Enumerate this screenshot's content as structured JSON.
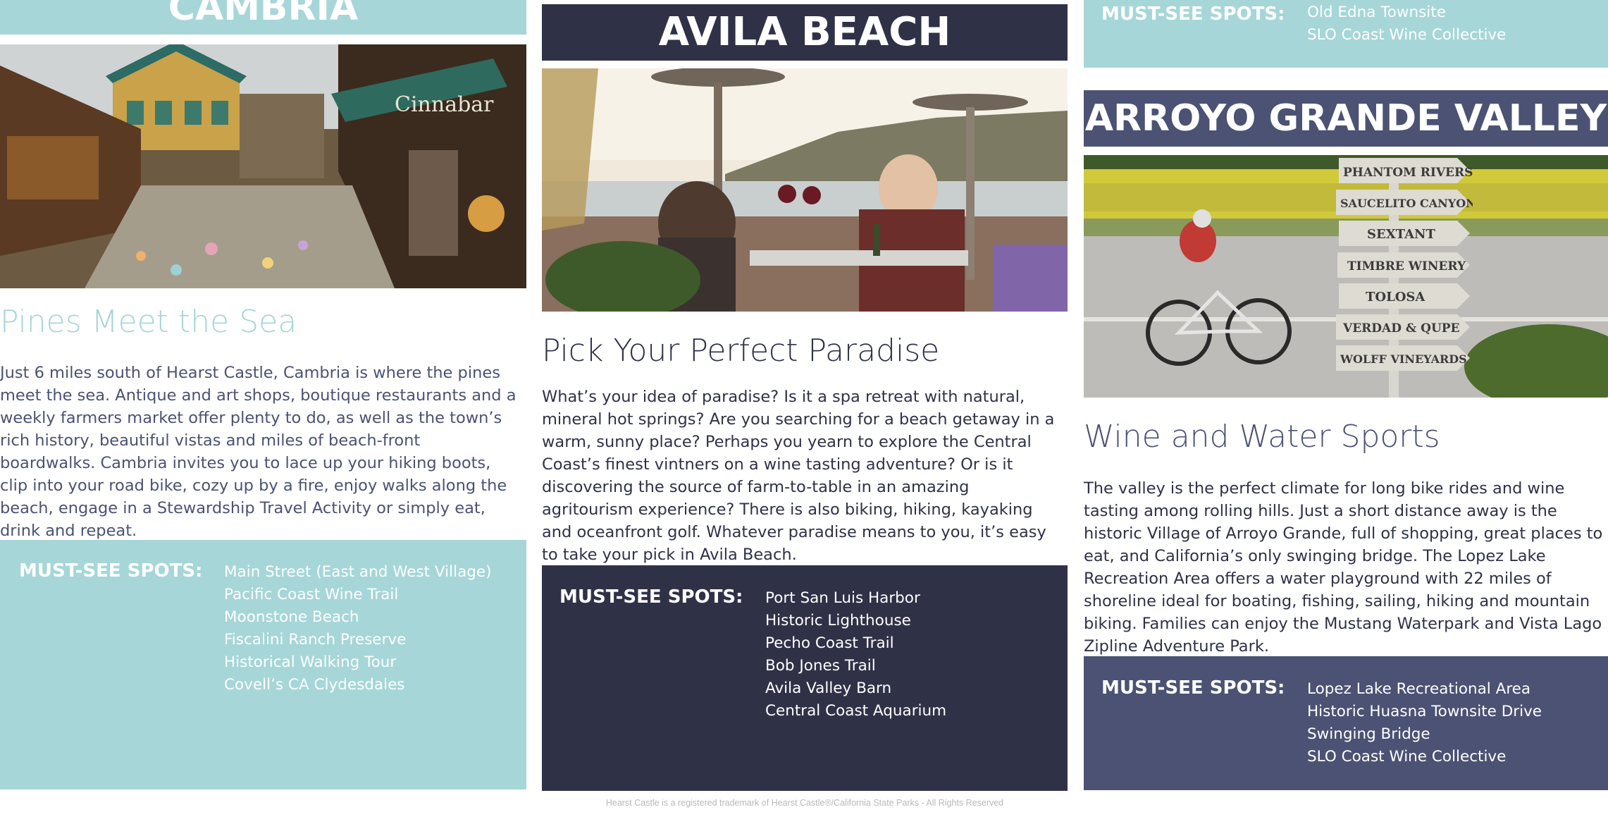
{
  "colors": {
    "cambria": "#a6d6d8",
    "avila": "#2f3247",
    "arroyo": "#4b5273",
    "text": "#2f3247"
  },
  "cambria": {
    "banner": "CAMBRIA",
    "subheading": "Pines Meet the Sea",
    "body": "Just 6 miles south of Hearst Castle, Cambria is where the pines meet the sea. Antique and art shops, boutique restaurants and a weekly farmers market offer plenty to do, as well as the town’s rich history, beautiful vistas and miles of beach-front boardwalks. Cambria invites you to lace up your hiking boots, clip into your road bike, cozy up by a fire, enjoy walks along the beach, engage in a Stewardship Travel Activity or simply eat, drink and repeat.",
    "spots_label": "MUST-SEE SPOTS:",
    "spots": [
      "Main Street (East and West Village)",
      "Pacific Coast Wine Trail",
      "Moonstone Beach",
      "Fiscalini Ranch Preserve",
      "Historical Walking Tour",
      "Covell’s CA Clydesdales"
    ],
    "photo_sign": "Cinnabar"
  },
  "avila": {
    "banner": "AVILA BEACH",
    "subheading": "Pick Your Perfect Paradise",
    "body": "What’s your idea of paradise? Is it a spa retreat with natural, mineral hot springs? Are you searching for a beach getaway in a warm, sunny place? Perhaps you yearn to explore the Central Coast’s finest vintners on a wine tasting adventure? Or is it discovering the source of farm-to-table in an amazing agritourism experience? There is also biking, hiking, kayaking and oceanfront golf. Whatever paradise means to you, it’s easy to take your pick in Avila Beach.",
    "spots_label": "MUST-SEE SPOTS:",
    "spots": [
      "Port San Luis Harbor",
      "Historic Lighthouse",
      "Pecho Coast Trail",
      "Bob Jones Trail",
      "Avila Valley Barn",
      "Central Coast Aquarium"
    ]
  },
  "prev_panel": {
    "spots_label": "MUST-SEE SPOTS:",
    "spots": [
      "Old Edna Townsite",
      "SLO Coast Wine Collective"
    ]
  },
  "arroyo": {
    "banner": "ARROYO GRANDE VALLEY",
    "subheading": "Wine and Water Sports",
    "body": "The valley is the perfect climate for long bike rides and wine tasting among rolling hills. Just a short distance away is the historic Village of Arroyo Grande, full of shopping, great places to eat, and California’s only swinging bridge. The Lopez Lake Recreation Area offers a water playground with 22 miles of shoreline ideal for boating, fishing, sailing, hiking and mountain biking. Families can enjoy the Mustang Waterpark and Vista Lago Zipline Adventure Park.",
    "spots_label": "MUST-SEE SPOTS:",
    "spots": [
      "Lopez Lake Recreational Area",
      "Historic Huasna Townsite Drive",
      "Swinging Bridge",
      "SLO Coast Wine Collective"
    ],
    "signpost": [
      "PHANTOM RIVERS",
      "SAUCELITO CANYON",
      "SEXTANT",
      "TIMBRE WINERY",
      "TOLOSA",
      "VERDAD & QUPE",
      "WOLFF VINEYARDS"
    ]
  },
  "footnote": "Hearst Castle is a registered trademark of Hearst Castle®/California State Parks - All Rights Reserved"
}
